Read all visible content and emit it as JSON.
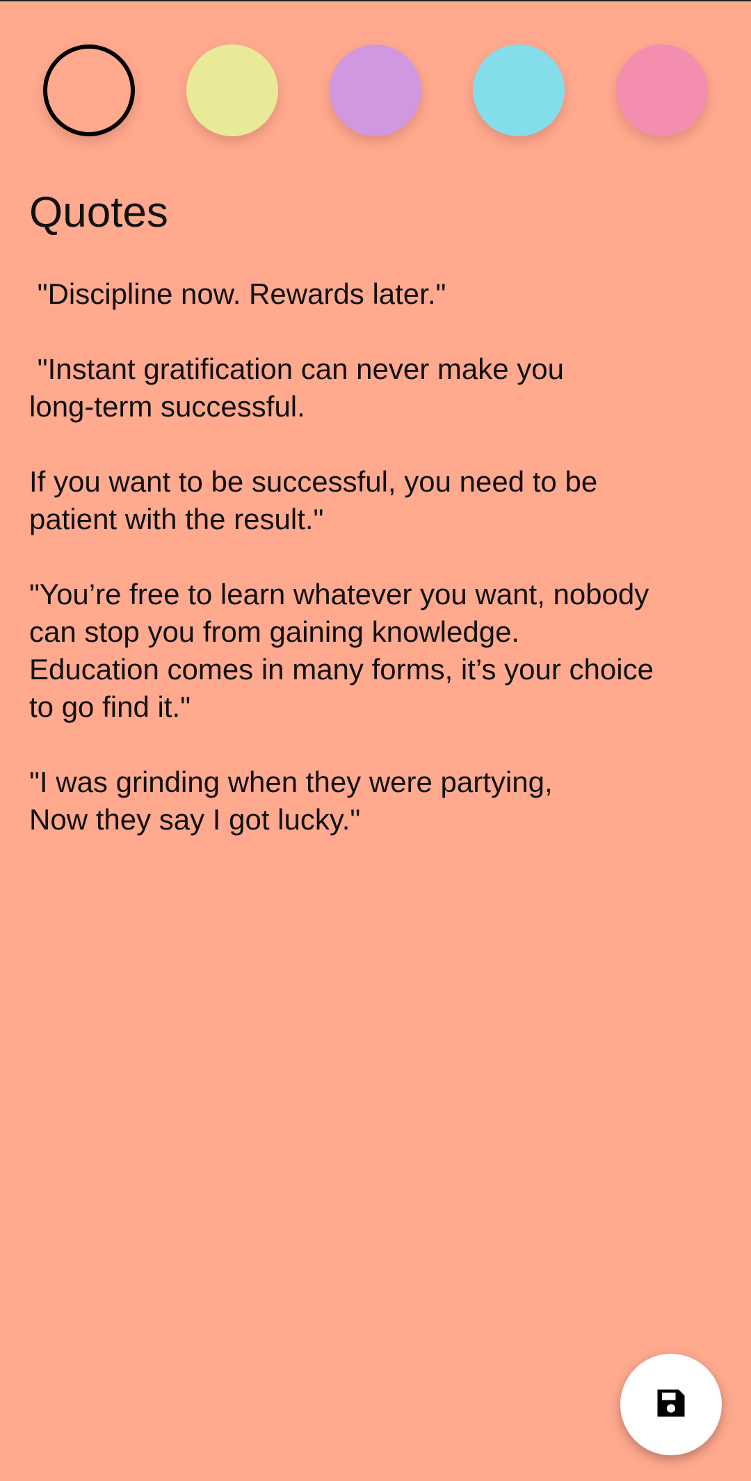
{
  "colors": {
    "background": "#FFA98F",
    "swatches": [
      "#FFA98F",
      "#E8EA98",
      "#D197DF",
      "#84DDEB",
      "#F38EAE"
    ],
    "selected_index": 0
  },
  "note": {
    "title": "Quotes",
    "body": " \"Discipline now. Rewards later.\"\n\n \"Instant gratification can never make you\nlong-term successful.\n\nIf you want to be successful, you need to be\npatient with the result.\"\n\n\"You’re free to learn whatever you want, nobody\ncan stop you from gaining knowledge.\nEducation comes in many forms, it’s your choice\nto go find it.\"\n\n\"I was grinding when they were partying,\nNow they say I got lucky.\""
  },
  "fab": {
    "icon": "save-icon"
  }
}
